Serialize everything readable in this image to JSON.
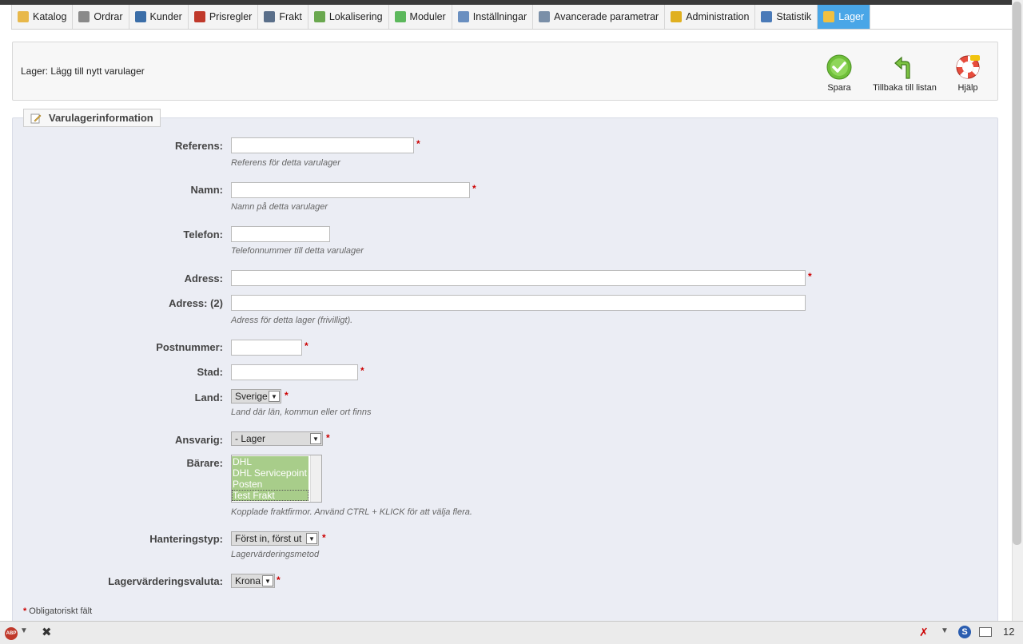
{
  "nav": {
    "tabs": [
      {
        "label": "Katalog",
        "icon": "folder-icon",
        "color": "#e8b84a"
      },
      {
        "label": "Ordrar",
        "icon": "cart-icon",
        "color": "#8a8a8a"
      },
      {
        "label": "Kunder",
        "icon": "user-icon",
        "color": "#3b6ea8"
      },
      {
        "label": "Prisregler",
        "icon": "price-rules-icon",
        "color": "#c0392b"
      },
      {
        "label": "Frakt",
        "icon": "truck-icon",
        "color": "#5a6f8a"
      },
      {
        "label": "Lokalisering",
        "icon": "globe-icon",
        "color": "#6aa84f"
      },
      {
        "label": "Moduler",
        "icon": "puzzle-icon",
        "color": "#5cb85c"
      },
      {
        "label": "Inställningar",
        "icon": "settings-icon",
        "color": "#6a8fc0"
      },
      {
        "label": "Avancerade parametrar",
        "icon": "wrench-icon",
        "color": "#7a8fa8"
      },
      {
        "label": "Administration",
        "icon": "key-icon",
        "color": "#e0b020"
      },
      {
        "label": "Statistik",
        "icon": "chart-icon",
        "color": "#4a7ab8"
      },
      {
        "label": "Lager",
        "icon": "stock-icon",
        "color": "#f0c040",
        "active": true
      }
    ]
  },
  "header": {
    "title": "Lager: Lägg till nytt varulager",
    "save_label": "Spara",
    "back_label": "Tillbaka till listan",
    "help_label": "Hjälp"
  },
  "form": {
    "legend": "Varulagerinformation",
    "reference": {
      "label": "Referens:",
      "value": "",
      "hint": "Referens för detta varulager"
    },
    "name": {
      "label": "Namn:",
      "value": "",
      "hint": "Namn på detta varulager"
    },
    "phone": {
      "label": "Telefon:",
      "value": "",
      "hint": "Telefonnummer till detta varulager"
    },
    "address": {
      "label": "Adress:",
      "value": ""
    },
    "address2": {
      "label": "Adress: (2)",
      "value": "",
      "hint": "Adress för detta lager (frivilligt)."
    },
    "postcode": {
      "label": "Postnummer:",
      "value": ""
    },
    "city": {
      "label": "Stad:",
      "value": ""
    },
    "country": {
      "label": "Land:",
      "selected": "Sverige",
      "hint": "Land där län, kommun eller ort finns"
    },
    "manager": {
      "label": "Ansvarig:",
      "selected": "- Lager"
    },
    "carriers": {
      "label": "Bärare:",
      "options": [
        "DHL",
        "DHL Servicepoint",
        "Posten",
        "Test Frakt"
      ],
      "hint": "Kopplade fraktfirmor. Använd CTRL + KLICK för att välja flera."
    },
    "management_type": {
      "label": "Hanteringstyp:",
      "selected": "Först in, först ut",
      "hint": "Lagervärderingsmetod"
    },
    "currency": {
      "label": "Lagervärderingsvaluta:",
      "selected": "Krona"
    },
    "required_note": "Obligatoriskt fält",
    "required_marker": "*"
  },
  "statusbar": {
    "abp_label": "ABP",
    "count": "12"
  }
}
